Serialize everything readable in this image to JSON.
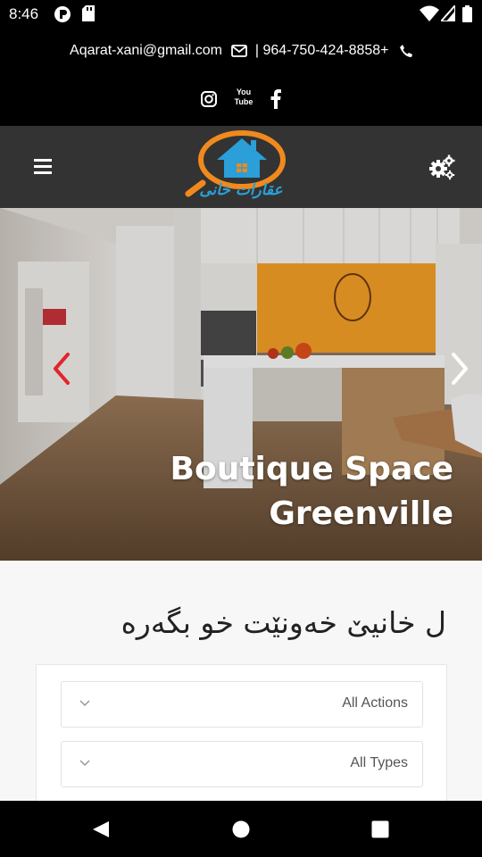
{
  "status_bar": {
    "time": "8:46",
    "left_icons": [
      "app-notification-icon",
      "sd-card-icon"
    ],
    "right_icons": [
      "wifi-icon",
      "cell-signal-icon",
      "battery-icon"
    ]
  },
  "contact": {
    "email": "Aqarat-xani@gmail.com",
    "separator": "|",
    "phone": "964-750-424-8858+",
    "icons": [
      "envelope-icon",
      "phone-icon"
    ]
  },
  "social": {
    "youtube_label": "You Tube",
    "icons": [
      "instagram-icon",
      "youtube-icon",
      "facebook-icon"
    ]
  },
  "header": {
    "logo_text": "عقارات خانى",
    "menu_icon": "hamburger-menu-icon",
    "settings_icon": "gears-icon"
  },
  "hero": {
    "title_line1": "Boutique Space",
    "title_line2": "Greenville",
    "prev_icon": "chevron-left-icon",
    "next_icon": "chevron-right-icon"
  },
  "search": {
    "heading": "ل خانیێ خەونێت خو بگەرە",
    "action_select": "All Actions",
    "type_select": "All Types"
  },
  "colors": {
    "header_bg": "#333333",
    "logo_orange": "#F08A1E",
    "logo_blue": "#2A9FD8",
    "arrow_red": "#E0262B",
    "page_bg": "#F7F7F7"
  },
  "android_nav": {
    "icons": [
      "back-triangle-icon",
      "home-circle-icon",
      "recents-square-icon"
    ]
  }
}
